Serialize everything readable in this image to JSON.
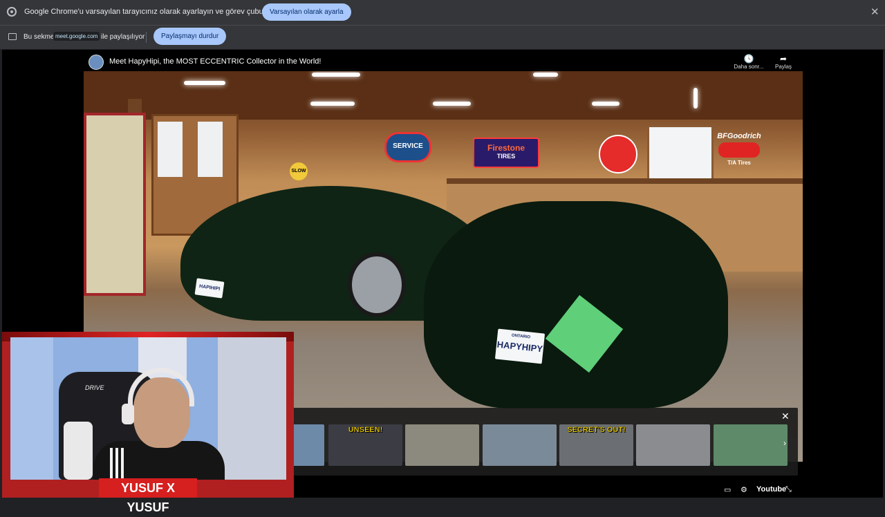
{
  "chrome": {
    "infobar": {
      "message": "Google Chrome'u varsayılan tarayıcınız olarak ayarlayın ve görev çubuğunuza sabitleyin",
      "button": "Varsayılan olarak ayarla",
      "close": "✕"
    },
    "sharebar": {
      "prefix": "Bu sekme",
      "url": "meet.google.com",
      "suffix": "ile paylaşılıyor",
      "button": "Paylaşmayı durdur"
    }
  },
  "video": {
    "title": "Meet HapyHipi, the MOST ECCENTRIC Collector in the World!",
    "watch_later": "Daha sonr...",
    "share": "Paylaş",
    "signs": {
      "service": "SERVICE",
      "firestone": "Firestone",
      "tires": "TIRES",
      "bfgoodrich": "BFGoodrich",
      "tatires": "T/A Tires",
      "slow": "SLOW"
    },
    "plates": {
      "car1": "HAPIHIPI",
      "car2": "HAPYHIPY",
      "car2_top": "ONTARIO"
    },
    "endscreen": {
      "thumbnails": [
        {
          "caption": "",
          "color": "#6d8aa8"
        },
        {
          "caption": "UNSEEN!",
          "color": "#3c3c44"
        },
        {
          "caption": "",
          "color": "#8c8a7e"
        },
        {
          "caption": "",
          "color": "#7a8a98"
        },
        {
          "caption": "SECRET'S OUT!",
          "color": "#6b6e72"
        },
        {
          "caption": "",
          "color": "#8a8c90"
        },
        {
          "caption": "",
          "color": "#5e8a6a"
        }
      ],
      "close": "✕",
      "next": "›"
    },
    "controls": {
      "youtube": "Youtube"
    }
  },
  "webcam": {
    "banner": "YUSUF X YUSUF",
    "chair_brand": "DRIVE"
  }
}
